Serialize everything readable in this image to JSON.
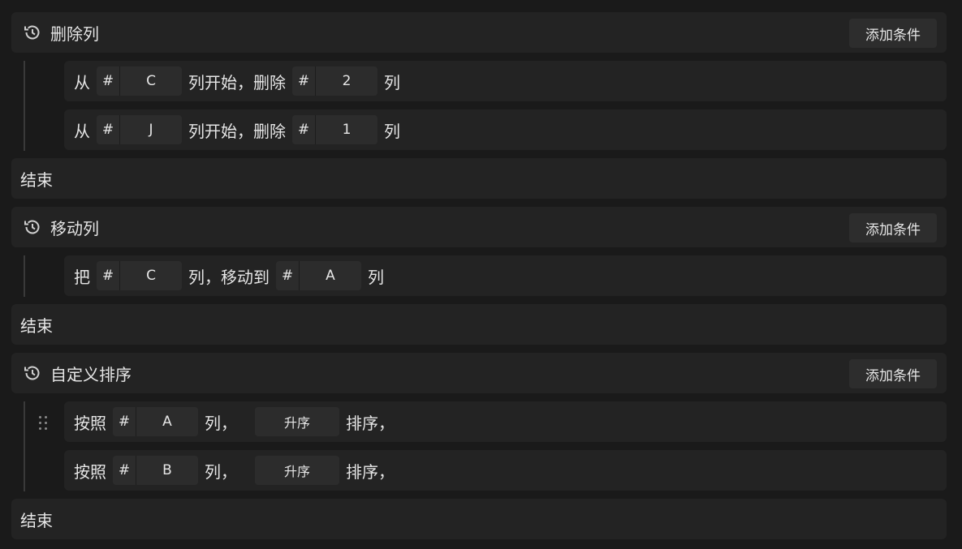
{
  "blocks": [
    {
      "title": "删除列",
      "add_button": "添加条件",
      "rows": [
        {
          "prefix": "从",
          "start_hash": "#",
          "start_col": "C",
          "middle": "列开始，删除",
          "count_hash": "#",
          "count": "2",
          "suffix": "列"
        },
        {
          "prefix": "从",
          "start_hash": "#",
          "start_col": "J",
          "middle": "列开始，删除",
          "count_hash": "#",
          "count": "1",
          "suffix": "列"
        }
      ],
      "end_label": "结束"
    },
    {
      "title": "移动列",
      "add_button": "添加条件",
      "rows": [
        {
          "prefix": "把",
          "from_hash": "#",
          "from_col": "C",
          "middle": "列，移动到",
          "to_hash": "#",
          "to_col": "A",
          "suffix": "列"
        }
      ],
      "end_label": "结束"
    },
    {
      "title": "自定义排序",
      "add_button": "添加条件",
      "rows": [
        {
          "prefix": "按照",
          "col_hash": "#",
          "col": "A",
          "middle": "列，",
          "order": "升序",
          "suffix": "排序，"
        },
        {
          "prefix": "按照",
          "col_hash": "#",
          "col": "B",
          "middle": "列，",
          "order": "升序",
          "suffix": "排序，"
        }
      ],
      "end_label": "结束"
    }
  ],
  "icons": {
    "block_icon": "history-icon",
    "drag_icon": "drag-handle-icon"
  }
}
